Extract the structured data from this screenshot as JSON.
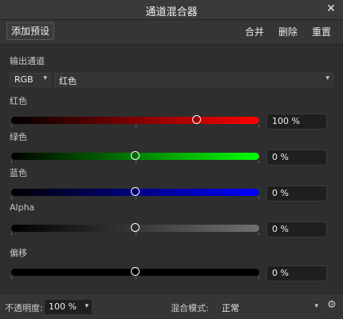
{
  "window": {
    "title": "通道混合器",
    "close_icon": "close-icon"
  },
  "toolbar": {
    "add_preset": "添加预设",
    "merge": "合并",
    "delete": "删除",
    "reset": "重置"
  },
  "output": {
    "label": "输出通道",
    "mode_value": "RGB",
    "channel_value": "红色"
  },
  "sliders": [
    {
      "label": "红色",
      "value_text": "100 %",
      "value": 0.75,
      "colors": [
        "#000000",
        "#ff0000"
      ]
    },
    {
      "label": "绿色",
      "value_text": "0 %",
      "value": 0.5,
      "colors": [
        "#000000",
        "#00ff00"
      ]
    },
    {
      "label": "蓝色",
      "value_text": "0 %",
      "value": 0.5,
      "colors": [
        "#000000",
        "#0000ff"
      ]
    },
    {
      "label": "Alpha",
      "value_text": "0 %",
      "value": 0.5,
      "colors": [
        "#000000",
        "#707070"
      ]
    },
    {
      "label": "偏移",
      "value_text": "0 %",
      "value": 0.5,
      "colors": [
        "#000000",
        "#000000"
      ]
    }
  ],
  "footer": {
    "opacity_label": "不透明度:",
    "opacity_value": "100 %",
    "blend_label": "混合模式:",
    "blend_value": "正常",
    "settings_icon": "gear-icon"
  }
}
